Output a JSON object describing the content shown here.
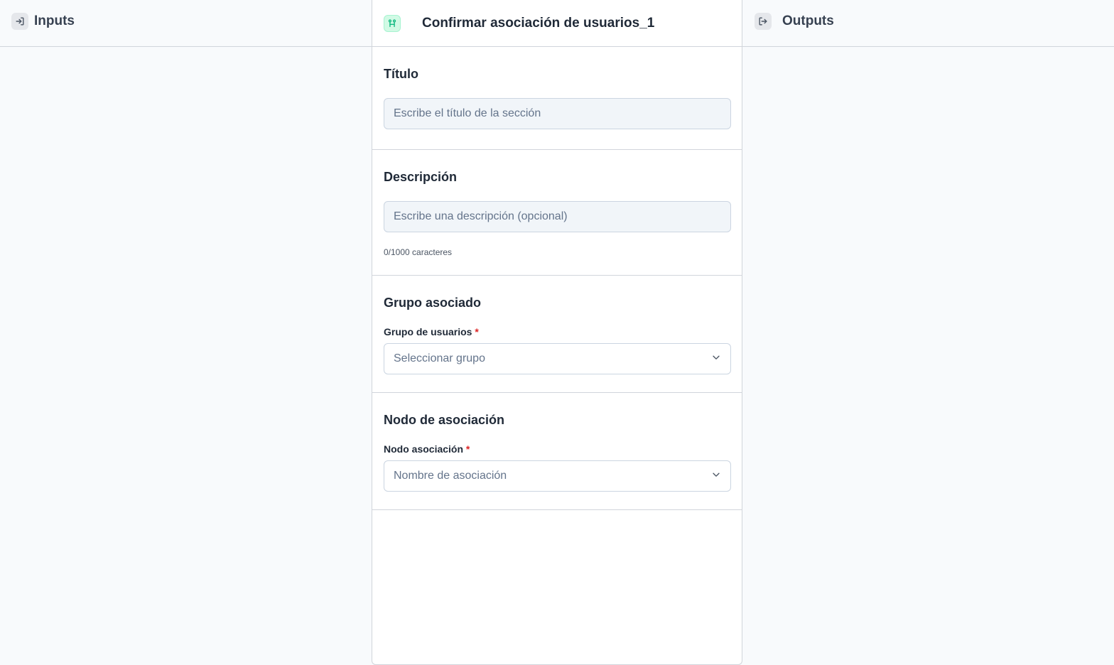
{
  "inputs_panel": {
    "title": "Inputs",
    "icon": "login-arrow-icon"
  },
  "outputs_panel": {
    "title": "Outputs",
    "icon": "logout-arrow-icon"
  },
  "node": {
    "title": "Confirmar asociación de usuarios_1",
    "icon": "user-group-icon",
    "accent_color": "#10b981"
  },
  "sections": {
    "titulo": {
      "heading": "Título",
      "placeholder": "Escribe el título de la sección",
      "value": ""
    },
    "descripcion": {
      "heading": "Descripción",
      "placeholder": "Escribe una descripción (opcional)",
      "value": "",
      "counter": "0/1000 caracteres"
    },
    "grupo": {
      "heading": "Grupo asociado",
      "field_label": "Grupo de usuarios",
      "required_mark": "*",
      "selected": "Seleccionar grupo"
    },
    "nodo": {
      "heading": "Nodo de asociación",
      "field_label": "Nodo asociación",
      "required_mark": "*",
      "selected": "Nombre de asociación"
    }
  }
}
